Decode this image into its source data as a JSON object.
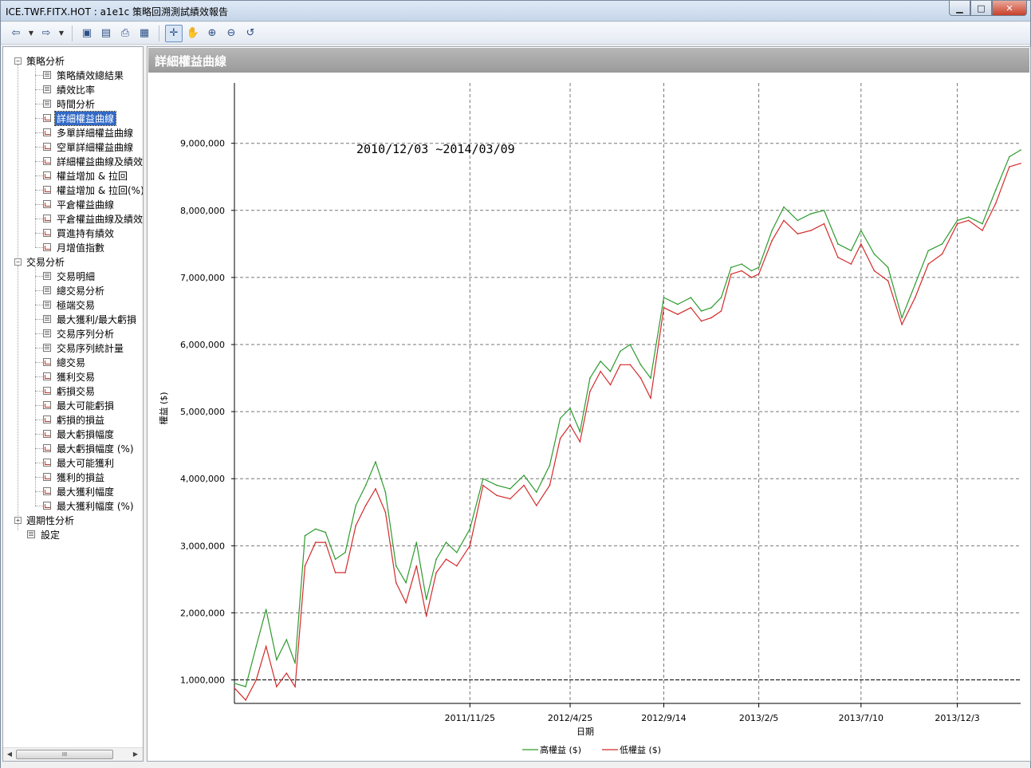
{
  "window": {
    "title": "ICE.TWF.FITX.HOT : a1e1c 策略回溯測試績效報告",
    "controls": {
      "minimize": "▁",
      "maximize": "□",
      "close": "✕"
    }
  },
  "toolbar": {
    "icons": [
      "back-icon",
      "dropdown-icon",
      "forward-icon",
      "dropdown-icon",
      "save-icon",
      "export-icon",
      "print-icon",
      "table-icon",
      "crosshair-icon",
      "hand-icon",
      "zoom-in-icon",
      "zoom-out-icon",
      "reset-icon"
    ]
  },
  "sidebar": {
    "tree": [
      {
        "label": "策略分析",
        "level": 0,
        "expander": "−"
      },
      {
        "label": "策略績效總結果",
        "level": 1,
        "icon": "table"
      },
      {
        "label": "績效比率",
        "level": 1,
        "icon": "table"
      },
      {
        "label": "時間分析",
        "level": 1,
        "icon": "table"
      },
      {
        "label": "詳細權益曲線",
        "level": 1,
        "icon": "chart",
        "selected": true
      },
      {
        "label": "多單詳細權益曲線",
        "level": 1,
        "icon": "chart"
      },
      {
        "label": "空單詳細權益曲線",
        "level": 1,
        "icon": "chart"
      },
      {
        "label": "詳細權益曲線及績效",
        "level": 1,
        "icon": "chart"
      },
      {
        "label": "權益增加 & 拉回",
        "level": 1,
        "icon": "chart"
      },
      {
        "label": "權益增加 & 拉回(%)",
        "level": 1,
        "icon": "chart"
      },
      {
        "label": "平倉權益曲線",
        "level": 1,
        "icon": "chart"
      },
      {
        "label": "平倉權益曲線及績效",
        "level": 1,
        "icon": "chart"
      },
      {
        "label": "買進持有績效",
        "level": 1,
        "icon": "chart"
      },
      {
        "label": "月增值指數",
        "level": 1,
        "icon": "chart"
      },
      {
        "label": "交易分析",
        "level": 0,
        "expander": "−"
      },
      {
        "label": "交易明細",
        "level": 1,
        "icon": "table"
      },
      {
        "label": "總交易分析",
        "level": 1,
        "icon": "table"
      },
      {
        "label": "極端交易",
        "level": 1,
        "icon": "table"
      },
      {
        "label": "最大獲利/最大虧損",
        "level": 1,
        "icon": "table"
      },
      {
        "label": "交易序列分析",
        "level": 1,
        "icon": "table"
      },
      {
        "label": "交易序列統計量",
        "level": 1,
        "icon": "table"
      },
      {
        "label": "總交易",
        "level": 1,
        "icon": "chart"
      },
      {
        "label": "獲利交易",
        "level": 1,
        "icon": "chart"
      },
      {
        "label": "虧損交易",
        "level": 1,
        "icon": "chart"
      },
      {
        "label": "最大可能虧損",
        "level": 1,
        "icon": "chart"
      },
      {
        "label": "虧損的損益",
        "level": 1,
        "icon": "chart"
      },
      {
        "label": "最大虧損幅度",
        "level": 1,
        "icon": "chart"
      },
      {
        "label": "最大虧損幅度 (%)",
        "level": 1,
        "icon": "chart"
      },
      {
        "label": "最大可能獲利",
        "level": 1,
        "icon": "chart"
      },
      {
        "label": "獲利的損益",
        "level": 1,
        "icon": "chart"
      },
      {
        "label": "最大獲利幅度",
        "level": 1,
        "icon": "chart"
      },
      {
        "label": "最大獲利幅度 (%)",
        "level": 1,
        "icon": "chart"
      },
      {
        "label": "週期性分析",
        "level": 0,
        "expander": "+"
      },
      {
        "label": "設定",
        "level": 0,
        "icon": "table"
      }
    ],
    "scroll_thumb": "III"
  },
  "main": {
    "title": "詳細權益曲線"
  },
  "chart_data": {
    "type": "line",
    "date_range_label": "2010/12/03 ~2014/03/09",
    "xlabel": "日期",
    "ylabel": "權益 ($)",
    "x_ticks": [
      "2011/11/25",
      "2012/4/25",
      "2012/9/14",
      "2013/2/5",
      "2013/7/10",
      "2013/12/3"
    ],
    "y_ticks": [
      1000000,
      2000000,
      3000000,
      4000000,
      5000000,
      6000000,
      7000000,
      8000000,
      9000000
    ],
    "y_tick_labels": [
      "1,000,000",
      "2,000,000",
      "3,000,000",
      "4,000,000",
      "5,000,000",
      "6,000,000",
      "7,000,000",
      "8,000,000",
      "9,000,000"
    ],
    "ylim": [
      650000,
      9900000
    ],
    "x_range": [
      "2010/12/03",
      "2014/03/09"
    ],
    "grid": true,
    "reference_line": 1000000,
    "legend_position": "bottom",
    "x_dates": [
      "2010/12/03",
      "2010/12/20",
      "2011/01/05",
      "2011/01/20",
      "2011/02/05",
      "2011/02/20",
      "2011/03/05",
      "2011/03/20",
      "2011/04/05",
      "2011/04/20",
      "2011/05/05",
      "2011/05/20",
      "2011/06/05",
      "2011/06/20",
      "2011/07/05",
      "2011/07/20",
      "2011/08/05",
      "2011/08/20",
      "2011/09/05",
      "2011/09/20",
      "2011/10/05",
      "2011/10/20",
      "2011/11/05",
      "2011/11/25",
      "2011/12/15",
      "2012/01/05",
      "2012/01/25",
      "2012/02/15",
      "2012/03/05",
      "2012/03/25",
      "2012/04/10",
      "2012/04/25",
      "2012/05/10",
      "2012/05/25",
      "2012/06/10",
      "2012/06/25",
      "2012/07/10",
      "2012/07/25",
      "2012/08/10",
      "2012/08/25",
      "2012/09/14",
      "2012/10/05",
      "2012/10/25",
      "2012/11/10",
      "2012/11/25",
      "2012/12/10",
      "2012/12/25",
      "2013/01/10",
      "2013/01/25",
      "2013/02/05",
      "2013/02/25",
      "2013/03/15",
      "2013/04/05",
      "2013/04/25",
      "2013/05/15",
      "2013/06/05",
      "2013/06/25",
      "2013/07/10",
      "2013/07/30",
      "2013/08/20",
      "2013/09/10",
      "2013/09/30",
      "2013/10/20",
      "2013/11/10",
      "2013/12/03",
      "2013/12/20",
      "2014/01/10",
      "2014/01/30",
      "2014/02/20",
      "2014/03/09"
    ],
    "series": [
      {
        "name": "高權益 ($)",
        "color": "#2e9a2e",
        "values": [
          950000,
          900000,
          1500000,
          2050000,
          1300000,
          1600000,
          1250000,
          3150000,
          3250000,
          3200000,
          2800000,
          2900000,
          3600000,
          3900000,
          4250000,
          3800000,
          2700000,
          2450000,
          3050000,
          2200000,
          2800000,
          3050000,
          2900000,
          3250000,
          4000000,
          3900000,
          3850000,
          4050000,
          3800000,
          4200000,
          4900000,
          5050000,
          4700000,
          5500000,
          5750000,
          5600000,
          5900000,
          6000000,
          5700000,
          5500000,
          6700000,
          6600000,
          6700000,
          6500000,
          6550000,
          6700000,
          7150000,
          7200000,
          7100000,
          7150000,
          7700000,
          8050000,
          7850000,
          7950000,
          8000000,
          7500000,
          7400000,
          7700000,
          7350000,
          7150000,
          6400000,
          6900000,
          7400000,
          7500000,
          7850000,
          7900000,
          7800000,
          8300000,
          8800000,
          8900000
        ]
      },
      {
        "name": "低權益 ($)",
        "color": "#d42a2a",
        "values": [
          880000,
          700000,
          1000000,
          1500000,
          900000,
          1100000,
          900000,
          2700000,
          3050000,
          3050000,
          2600000,
          2600000,
          3300000,
          3600000,
          3850000,
          3500000,
          2450000,
          2150000,
          2700000,
          1950000,
          2600000,
          2800000,
          2700000,
          3000000,
          3900000,
          3750000,
          3700000,
          3900000,
          3600000,
          3900000,
          4600000,
          4800000,
          4550000,
          5300000,
          5600000,
          5400000,
          5700000,
          5700000,
          5500000,
          5200000,
          6550000,
          6450000,
          6550000,
          6350000,
          6400000,
          6500000,
          7050000,
          7100000,
          7000000,
          7050000,
          7550000,
          7850000,
          7650000,
          7700000,
          7800000,
          7300000,
          7200000,
          7500000,
          7100000,
          6950000,
          6300000,
          6700000,
          7200000,
          7350000,
          7800000,
          7850000,
          7700000,
          8100000,
          8650000,
          8700000
        ]
      }
    ]
  }
}
